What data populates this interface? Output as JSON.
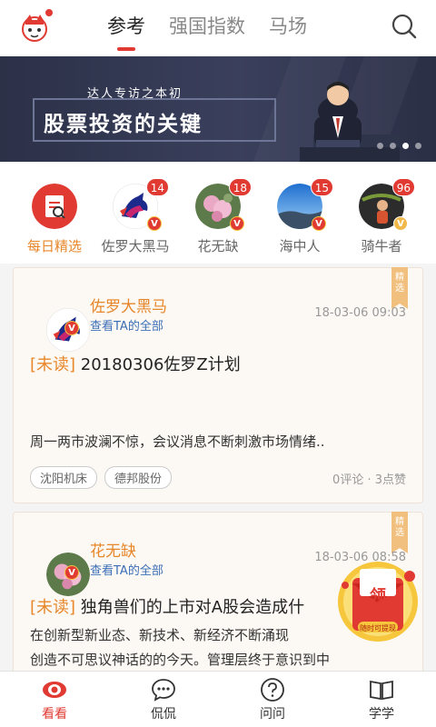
{
  "topnav": {
    "tabs": [
      {
        "label": "参考",
        "active": true
      },
      {
        "label": "强国指数",
        "active": false
      },
      {
        "label": "马场",
        "active": false
      }
    ]
  },
  "banner": {
    "subtitle": "达人专访之本初",
    "title": "股票投资的关键",
    "page_dots": 4,
    "active_dot": 3
  },
  "stories": [
    {
      "label": "每日精选",
      "count": "",
      "highlight": true
    },
    {
      "label": "佐罗大黑马",
      "count": "14",
      "highlight": false
    },
    {
      "label": "花无缺",
      "count": "18",
      "highlight": false
    },
    {
      "label": "海中人",
      "count": "15",
      "highlight": false
    },
    {
      "label": "骑牛者",
      "count": "96",
      "highlight": false
    }
  ],
  "posts": [
    {
      "ribbon": "精选",
      "author": "佐罗大黑马",
      "author_link": "查看TA的全部",
      "time": "18-03-06 09:03",
      "unread": "[未读]",
      "title": "20180306佐罗Z计划",
      "summary": "周一两市波澜不惊，会议消息不断刺激市场情绪..",
      "tags": [
        "沈阳机床",
        "德邦股份"
      ],
      "stats": "0评论 · 3点赞"
    },
    {
      "ribbon": "精选",
      "author": "花无缺",
      "author_link": "查看TA的全部",
      "time": "18-03-06 08:58",
      "unread": "[未读]",
      "title": "独角兽们的上市对A股会造成什",
      "body_line1": "在创新型新业态、新技术、新经济不断涌现",
      "body_line2": "创造不可思议神话的的今天。管理层终于意识到中"
    }
  ],
  "envelope": {
    "label": "领",
    "sub": "随时可提现"
  },
  "bottomnav": [
    {
      "label": "看看",
      "icon": "eye-icon",
      "active": true
    },
    {
      "label": "侃侃",
      "icon": "chat-icon",
      "active": false
    },
    {
      "label": "问问",
      "icon": "question-icon",
      "active": false
    },
    {
      "label": "学学",
      "icon": "book-icon",
      "active": false
    }
  ],
  "colors": {
    "accent": "#e03a32",
    "orange": "#e7872a",
    "link": "#3b6fb6"
  }
}
